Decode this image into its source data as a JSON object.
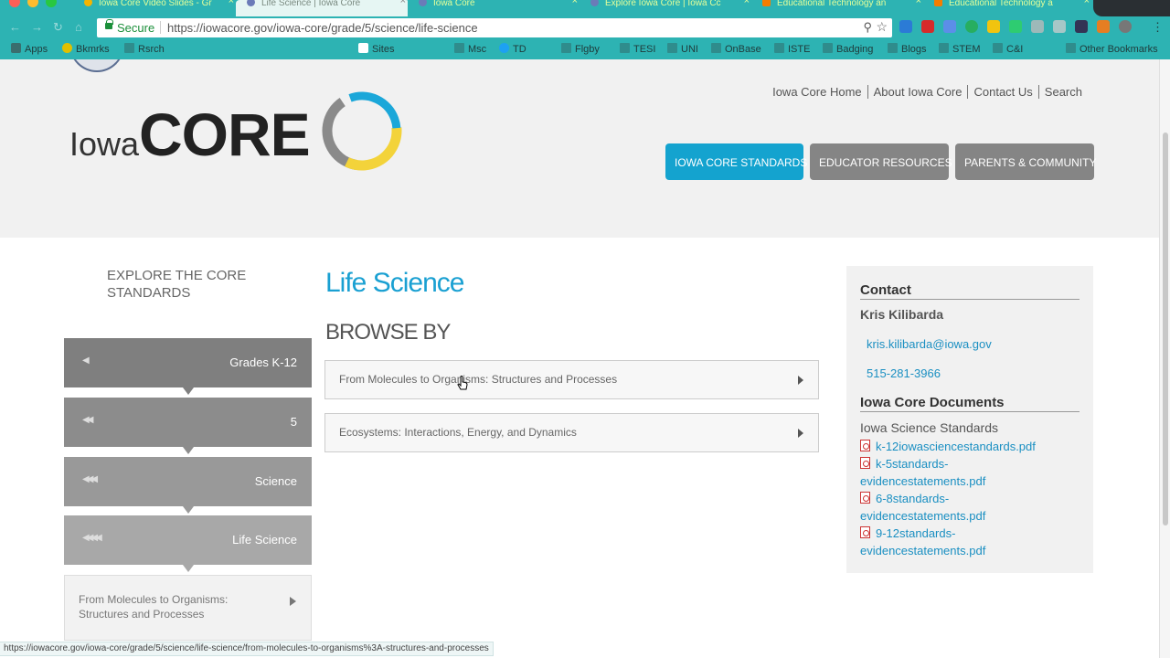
{
  "browser": {
    "tabs": [
      {
        "title": "Iowa Core Video Slides - Gr",
        "active": false
      },
      {
        "title": "Life Science | Iowa Core",
        "active": true
      },
      {
        "title": "Iowa Core",
        "active": false
      },
      {
        "title": "Explore Iowa Core | Iowa Cc",
        "active": false
      },
      {
        "title": "Educational Technology an",
        "active": false
      },
      {
        "title": "Educational Technology a",
        "active": false
      }
    ],
    "secure_label": "Secure",
    "url": "https://iowacore.gov/iowa-core/grade/5/science/life-science",
    "bookmarks": [
      "Apps",
      "Bkmrks",
      "Rsrch",
      "Sites",
      "Msc",
      "TD",
      "Flgby",
      "TESI",
      "UNI",
      "OnBase",
      "ISTE",
      "Badging",
      "Blogs",
      "STEM",
      "C&I",
      "Other Bookmarks"
    ],
    "status_url": "https://iowacore.gov/iowa-core/grade/5/science/life-science/from-molecules-to-organisms%3A-structures-and-processes"
  },
  "header": {
    "logo_iowa": "Iowa",
    "logo_core": "CORE",
    "top_links": [
      "Iowa Core Home",
      "About Iowa Core",
      "Contact Us",
      "Search"
    ],
    "nav": [
      "IOWA CORE STANDARDS",
      "EDUCATOR RESOURCES",
      "PARENTS & COMMUNITY"
    ]
  },
  "left": {
    "title": "EXPLORE THE CORE STANDARDS",
    "crumbs": [
      "Grades K-12",
      "5",
      "Science",
      "Life Science"
    ],
    "current": "From Molecules to Organisms: Structures and Processes"
  },
  "main": {
    "title": "Life Science",
    "browse_by": "BROWSE BY",
    "items": [
      "From Molecules to Organisms: Structures and Processes",
      "Ecosystems: Interactions, Energy, and Dynamics"
    ]
  },
  "sidebar": {
    "contact_heading": "Contact",
    "contact_name": "Kris Kilibarda",
    "email": "kris.kilibarda@iowa.gov",
    "phone": "515-281-3966",
    "docs_heading": "Iowa Core Documents",
    "docs_subheading": "Iowa Science Standards",
    "docs": [
      "k-12iowasciencestandards.pdf",
      "k-5standards-evidencestatements.pdf",
      "6-8standards-evidencestatements.pdf",
      "9-12standards-evidencestatements.pdf"
    ]
  },
  "colors": {
    "accent": "#14a3cf",
    "browser": "#2db3b3",
    "nav_gray": "#858585"
  }
}
